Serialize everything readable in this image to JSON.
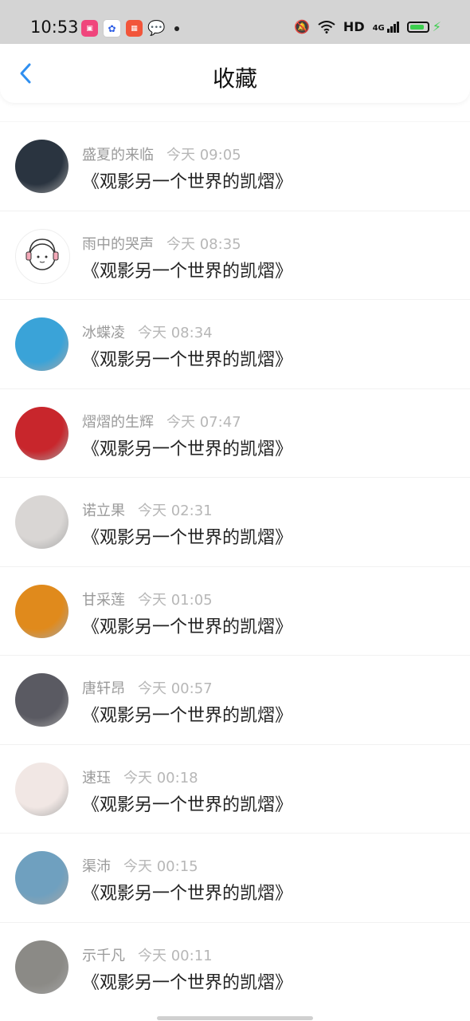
{
  "status_bar": {
    "time": "10:53",
    "network": "HD",
    "signal": "4G",
    "battery_level": 0.85,
    "app_icons": [
      "app-pink-icon",
      "baidu-icon",
      "app-orange-icon",
      "wechat-icon"
    ]
  },
  "header": {
    "title": "收藏",
    "back_icon": "chevron-left-icon",
    "accent": "#2f8ff0"
  },
  "items": [
    {
      "name": "盛夏的来临",
      "time": "今天 09:05",
      "content": "《观影另一个世界的凯熠》",
      "avatar_color": "#2a3440"
    },
    {
      "name": "雨中的哭声",
      "time": "今天 08:35",
      "content": "《观影另一个世界的凯熠》",
      "avatar_color": "#ffffff"
    },
    {
      "name": "冰蝶凌",
      "time": "今天 08:34",
      "content": "《观影另一个世界的凯熠》",
      "avatar_color": "#3aa3d8"
    },
    {
      "name": "熠熠的生辉",
      "time": "今天 07:47",
      "content": "《观影另一个世界的凯熠》",
      "avatar_color": "#c8262c"
    },
    {
      "name": "诺立果",
      "time": "今天 02:31",
      "content": "《观影另一个世界的凯熠》",
      "avatar_color": "#d9d6d4"
    },
    {
      "name": "甘采莲",
      "time": "今天 01:05",
      "content": "《观影另一个世界的凯熠》",
      "avatar_color": "#e08a1c"
    },
    {
      "name": "唐轩昂",
      "time": "今天 00:57",
      "content": "《观影另一个世界的凯熠》",
      "avatar_color": "#5a5a62"
    },
    {
      "name": "速珏",
      "time": "今天 00:18",
      "content": "《观影另一个世界的凯熠》",
      "avatar_color": "#f1e7e4"
    },
    {
      "name": "渠沛",
      "time": "今天 00:15",
      "content": "《观影另一个世界的凯熠》",
      "avatar_color": "#6fa0bf"
    },
    {
      "name": "示千凡",
      "time": "今天 00:11",
      "content": "《观影另一个世界的凯熠》",
      "avatar_color": "#8b8a86"
    }
  ]
}
